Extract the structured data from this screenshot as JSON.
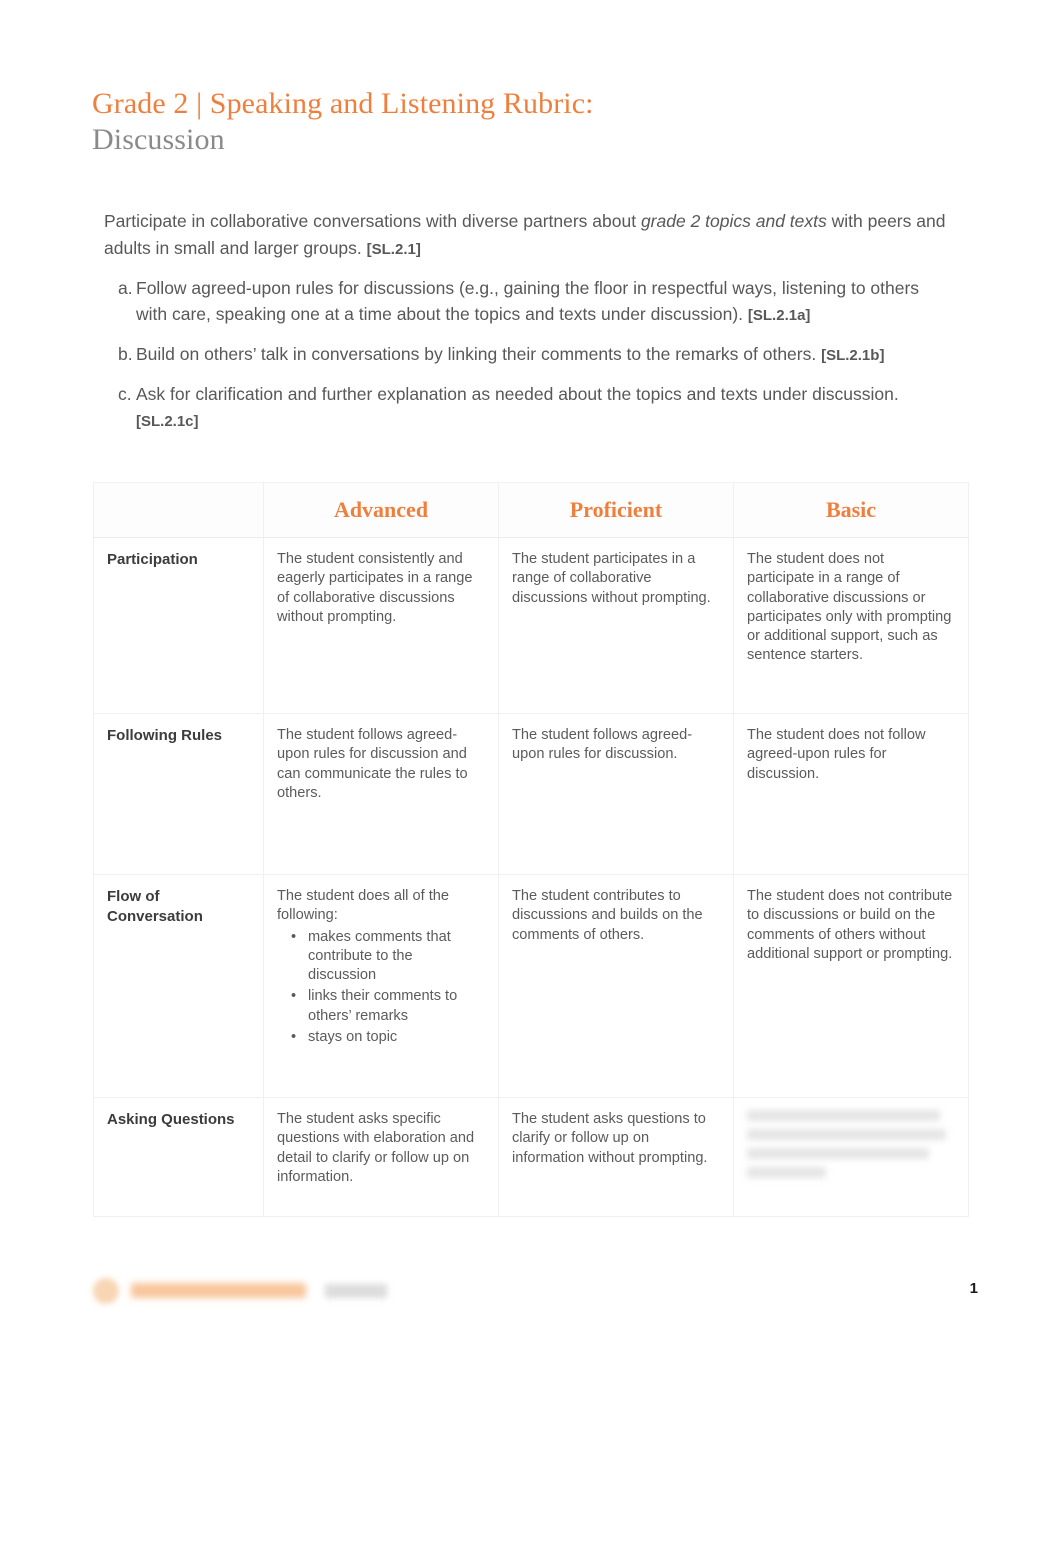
{
  "document": {
    "title_line1": "Grade 2 | Speaking and Listening Rubric:",
    "title_line2": "Discussion",
    "accent_color": "#ef7f3d",
    "page_number": "1"
  },
  "standard": {
    "main_text_before_italic": "Participate in collaborative conversations with diverse partners about ",
    "main_italic": "grade 2 topics and texts",
    "main_text_after_italic": " with peers and adults in small and larger groups. ",
    "main_code": "[SL.2.1]",
    "items": [
      {
        "marker": "a.",
        "text": "Follow agreed-upon rules for discussions (e.g., gaining the floor in respectful ways, listening to others with care, speaking one at a time about the topics and texts under discussion). ",
        "code": "[SL.2.1a]"
      },
      {
        "marker": "b.",
        "text": "Build on others’ talk in conversations by linking their comments to the remarks of others. ",
        "code": "[SL.2.1b]"
      },
      {
        "marker": "c.",
        "text": "Ask for clarification and further explanation as needed about the topics and texts under discussion. ",
        "code": "[SL.2.1c]"
      }
    ]
  },
  "rubric": {
    "headers": {
      "corner": "",
      "advanced": "Advanced",
      "proficient": "Proficient",
      "basic": "Basic"
    },
    "rows": [
      {
        "label": "Participation",
        "advanced": "The student consistently and eagerly participates in a range of collaborative discussions without prompting.",
        "proficient": "The student participates in a range of collaborative discussions without prompting.",
        "basic": "The student does not participate in a range of collaborative discussions or participates only with prompting or additional support, such as sentence starters."
      },
      {
        "label": "Following Rules",
        "advanced": "The student follows agreed-upon rules for discussion and can communicate the rules to others.",
        "proficient": "The student follows agreed-upon rules for discussion.",
        "basic": "The student does not follow agreed-upon rules for discussion."
      },
      {
        "label": "Flow of Conversation",
        "advanced_intro": "The student does all of the following:",
        "advanced_bullets": [
          "makes  comments that contribute to the discussion",
          "links their comments to others’ remarks",
          "stays on topic"
        ],
        "proficient": "The student contributes to discussions and builds on the comments of others.",
        "basic": "The student does not contribute to discussions or build on the comments of others without additional support or prompting."
      },
      {
        "label": "Asking Questions",
        "advanced": "The student asks specific questions with elaboration and detail to clarify or follow up on information.",
        "proficient": "The student asks questions to clarify or follow up on information without prompting.",
        "basic_redacted": true
      }
    ]
  }
}
